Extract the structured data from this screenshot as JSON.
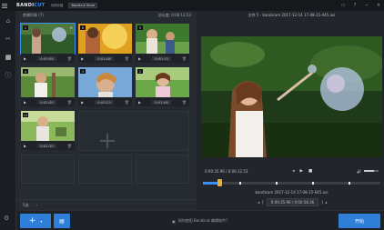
{
  "titlebar": {
    "logo_part1": "BANDI",
    "logo_part2": "CUT",
    "badge1": "电视收藏",
    "badge2": "Bandicut Store",
    "controls": [
      "▭",
      "?",
      "─",
      "✕"
    ]
  },
  "clip_panel": {
    "header_left": "剪辑列表 (7)",
    "header_right": "总长度: 0:06:12.53",
    "footer_left": "5选",
    "footer_arrow": "›"
  },
  "clips": [
    {
      "num": "1",
      "time": "0:00:58",
      "selected": true
    },
    {
      "num": "6",
      "time": "0:01:08",
      "selected": false
    },
    {
      "num": "5",
      "time": "0:00:13",
      "selected": false
    },
    {
      "num": "4",
      "time": "0:01:00",
      "selected": false
    },
    {
      "num": "3",
      "time": "0:00:23",
      "selected": false
    },
    {
      "num": "2",
      "time": "0:01:06",
      "selected": false
    },
    {
      "num": "10",
      "time": "0:01:20",
      "selected": false
    }
  ],
  "preview": {
    "title": "文件 5 - bandicam 2017-12-14 17-08-15-445.avi",
    "time_display": "0:00:35.96 / 0:06:12.53",
    "segment_title": "bandicam 2017-12-14 17-08-15-645.avi",
    "segment_time": "0:00:35.96 / 0:00:58.36",
    "progress": 0.09
  },
  "bottom": {
    "add_label": "+",
    "hint": "如何使用 Bandicut 编辑软件?",
    "start_label": "开始"
  },
  "colors": {
    "accent": "#2f7fd8",
    "knob": "#e8b230",
    "bg": "#22262c"
  }
}
